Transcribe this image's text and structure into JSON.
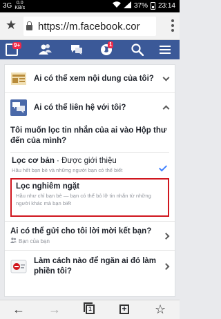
{
  "status_bar": {
    "network": "3G",
    "rate": "0.0\nKB/s",
    "battery": "37%",
    "time": "23:14"
  },
  "browser": {
    "url": "https://m.facebook.cor",
    "tab_count": "1"
  },
  "fb_nav": {
    "home_badge": "9+",
    "globe_badge": "1"
  },
  "settings": {
    "row1_title": "Ai có thể xem nội dung của tôi?",
    "row2_title": "Ai có thể liên hệ với tôi?",
    "question": "Tôi muốn lọc tin nhắn của ai vào Hộp thư đến của mình?",
    "option1": {
      "title": "Lọc cơ bản",
      "suffix": " · Được giới thiệu",
      "desc": "Hầu hết bạn bè và những người bạn có thể biết"
    },
    "option2": {
      "title": "Lọc nghiêm ngặt",
      "desc": "Hầu như chỉ bạn bè — bạn có thể bỏ lỡ tin nhắn từ những người khác mà bạn biết"
    },
    "row4_title": "Ai có thể gửi cho tôi lời mời kết bạn?",
    "row4_sub": "Bạn của bạn",
    "row5_title": "Làm cách nào để ngăn ai đó làm phiền tôi?"
  },
  "colors": {
    "fb_blue": "#3b5998",
    "highlight_red": "#d0161e",
    "check_blue": "#4080ff"
  }
}
